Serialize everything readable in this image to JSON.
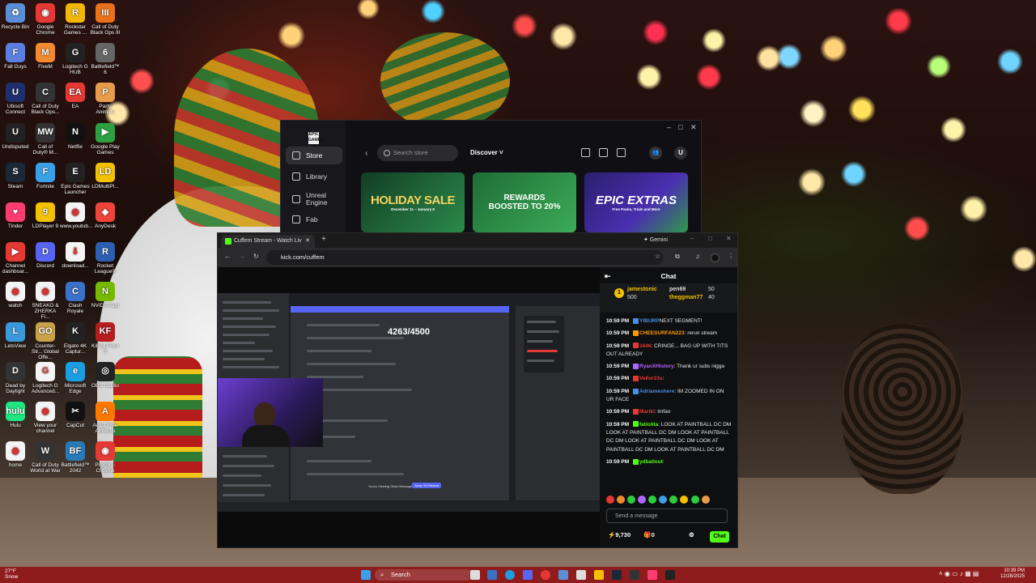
{
  "desktop": {
    "icons": [
      {
        "label": "Recycle Bin",
        "color": "#5a8fd8",
        "glyph": "♻"
      },
      {
        "label": "Google Chrome",
        "color": "#e53935",
        "glyph": "◉"
      },
      {
        "label": "Rockstar Games ...",
        "color": "#f2b705",
        "glyph": "R"
      },
      {
        "label": "Call of Duty Black Ops III",
        "color": "#e8711b",
        "glyph": "III"
      },
      {
        "label": "Fall Guys",
        "color": "#5a7fe0",
        "glyph": "F"
      },
      {
        "label": "FiveM",
        "color": "#f28b30",
        "glyph": "M"
      },
      {
        "label": "Logitech G HUB",
        "color": "#222",
        "glyph": "G"
      },
      {
        "label": "Battlefield™ 6",
        "color": "#666",
        "glyph": "6"
      },
      {
        "label": "Ubisoft Connect",
        "color": "#1f2e6e",
        "glyph": "U"
      },
      {
        "label": "Call of Duty Black Ops...",
        "color": "#333",
        "glyph": "C"
      },
      {
        "label": "EA",
        "color": "#e53935",
        "glyph": "EA"
      },
      {
        "label": "Party Animals",
        "color": "#e89b4a",
        "glyph": "P"
      },
      {
        "label": "Undisputed",
        "color": "#222",
        "glyph": "U"
      },
      {
        "label": "Call of Duty® M...",
        "color": "#333",
        "glyph": "MW"
      },
      {
        "label": "Netflix",
        "color": "#111",
        "glyph": "N"
      },
      {
        "label": "Google Play Games",
        "color": "#2ea043",
        "glyph": "▶"
      },
      {
        "label": "Steam",
        "color": "#1b2838",
        "glyph": "S"
      },
      {
        "label": "Fortnite",
        "color": "#3aa0e8",
        "glyph": "F"
      },
      {
        "label": "Epic Games Launcher",
        "color": "#222",
        "glyph": "E"
      },
      {
        "label": "LDMultiPl...",
        "color": "#f2c200",
        "glyph": "LD"
      },
      {
        "label": "Tinder",
        "color": "#fe3c72",
        "glyph": "♥"
      },
      {
        "label": "LDPlayer 9",
        "color": "#f2c200",
        "glyph": "9"
      },
      {
        "label": "www.youtub...",
        "color": "#f4f4f4",
        "glyph": "◉"
      },
      {
        "label": "AnyDesk",
        "color": "#ef443b",
        "glyph": "◆"
      },
      {
        "label": "Channel dashboar...",
        "color": "#e53935",
        "glyph": "▶"
      },
      {
        "label": "Discord",
        "color": "#5865f2",
        "glyph": "D"
      },
      {
        "label": "download...",
        "color": "#f4f4f4",
        "glyph": "⬇"
      },
      {
        "label": "Rocket League®",
        "color": "#2d5fb0",
        "glyph": "R"
      },
      {
        "label": "watch",
        "color": "#f4f4f4",
        "glyph": "◉"
      },
      {
        "label": "SNEAKO & ZHERKA Fi...",
        "color": "#f4f4f4",
        "glyph": "◉"
      },
      {
        "label": "Clash Royale",
        "color": "#3a72c8",
        "glyph": "C"
      },
      {
        "label": "NVIDIA App",
        "color": "#76b900",
        "glyph": "N"
      },
      {
        "label": "LetsView",
        "color": "#3a9ad9",
        "glyph": "L"
      },
      {
        "label": "Counter-Str... Global Offe...",
        "color": "#caa24a",
        "glyph": "GO"
      },
      {
        "label": "Elgato 4K Captur...",
        "color": "#222",
        "glyph": "K"
      },
      {
        "label": "Killing Floor 3",
        "color": "#b81d1d",
        "glyph": "KF"
      },
      {
        "label": "Dead by Daylight",
        "color": "#333",
        "glyph": "D"
      },
      {
        "label": "Logitech G Advanced...",
        "color": "#f4f4f4",
        "glyph": "G"
      },
      {
        "label": "Microsoft Edge",
        "color": "#1b9de2",
        "glyph": "e"
      },
      {
        "label": "OBS Studio",
        "color": "#222",
        "glyph": "◎"
      },
      {
        "label": "Hulu",
        "color": "#1ce783",
        "glyph": "hulu"
      },
      {
        "label": "View your channel",
        "color": "#f4f4f4",
        "glyph": "◉"
      },
      {
        "label": "CapCut",
        "color": "#111",
        "glyph": "✂"
      },
      {
        "label": "Avast Free Antivirus",
        "color": "#ff7800",
        "glyph": "A"
      },
      {
        "label": "home",
        "color": "#f4f4f4",
        "glyph": "◉"
      },
      {
        "label": "Call of Duty World at War",
        "color": "#333",
        "glyph": "W"
      },
      {
        "label": "Battlefield™ 2042",
        "color": "#2a7ab8",
        "glyph": "BF"
      },
      {
        "label": "Psycho - Chrome",
        "color": "#e53935",
        "glyph": "◉"
      }
    ]
  },
  "epic": {
    "logo": "EPIC GAMES",
    "nav": [
      "Store",
      "Library",
      "Unreal Engine",
      "Fab"
    ],
    "search_placeholder": "Search store",
    "discover": "Discover ˅",
    "banners": [
      {
        "title": "HOLIDAY SALE",
        "sub": "December 11 – January 8",
        "color": "#1f6b3a",
        "text": "#f4d35e"
      },
      {
        "title": "REWARDS BOOSTED TO 20%",
        "sub": "",
        "color": "#2f8f46",
        "text": "#ffffff"
      },
      {
        "title": "EPIC EXTRAS",
        "sub": "Free Packs, Trials and More",
        "color": "#3b2a8f",
        "text": "#ffffff"
      }
    ],
    "avatar": "U"
  },
  "browser": {
    "tab_title": "Cuffem Stream - Watch Liv",
    "gemini": "✦ Gemini",
    "url": "kick.com/cuffem",
    "goal": "4263/4500",
    "viewing_notice": "You're Viewing Older Messages",
    "jump_present": "Jump To Present"
  },
  "chat": {
    "title": "Chat",
    "pinned": [
      {
        "name": "jamestonic",
        "amount": "500"
      },
      {
        "name": "pen69",
        "amount": "50"
      },
      {
        "name": "theggman77",
        "amount": "40"
      }
    ],
    "messages": [
      {
        "time": "10:59 PM",
        "user": "YIBURP",
        "color": "#4a90e2",
        "text": "NEXT SEGMENT!"
      },
      {
        "time": "10:59 PM",
        "user": "CHEESURFAN223",
        "color": "#ff9900",
        "text": ": rerun stream"
      },
      {
        "time": "10:59 PM",
        "user": "1646",
        "color": "#e53935",
        "text": ": CRINGE... BAG UP WITH TITS OUT ALREADY"
      },
      {
        "time": "10:59 PM",
        "user": "RyanXHistory",
        "color": "#b066ff",
        "text": ": Thank ur subs nigga"
      },
      {
        "time": "10:59 PM",
        "user": "Vellor23s",
        "color": "#e53935",
        "text": ":"
      },
      {
        "time": "10:59 PM",
        "user": "Adriameshere",
        "color": "#4a90e2",
        "text": ": IM ZOOMED IN ON UR FACE"
      },
      {
        "time": "10:59 PM",
        "user": "Mariki",
        "color": "#e53935",
        "text": ": lmfao"
      },
      {
        "time": "10:59 PM",
        "user": "fatlolita",
        "color": "#53fc18",
        "text": ": LOOK AT PAINTBALL DC DM LOOK AT PAINTBALL DC DM LOOK AT PAINTBALL DC DM LOOK AT PAINTBALL DC DM LOOK AT PAINTBALL DC DM LOOK AT PAINTBALL DC DM"
      },
      {
        "time": "10:59 PM",
        "user": "ydballout",
        "color": "#53fc18",
        "text": ":"
      }
    ],
    "input_placeholder": "Send a message",
    "points": "9,730",
    "gifts": "0",
    "send": "Chat"
  },
  "taskbar": {
    "weather": "27°F",
    "weather_sub": "Snow",
    "search": "Search",
    "time": "10:39 PM",
    "date": "12/28/2025"
  }
}
